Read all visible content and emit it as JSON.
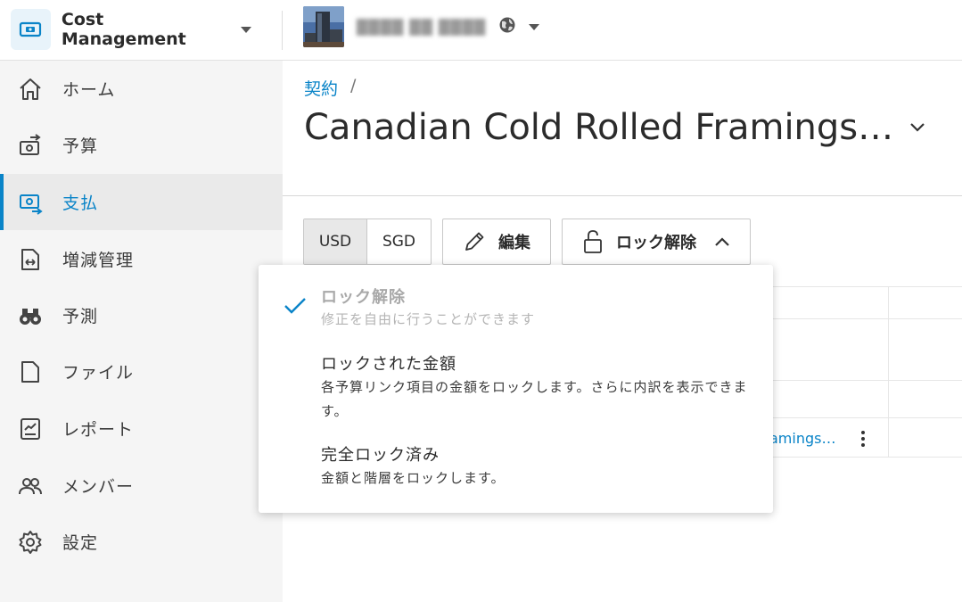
{
  "header": {
    "app_name": "Cost Management",
    "project_name": "████ ██ ████"
  },
  "sidebar": {
    "items": [
      {
        "label": "ホーム",
        "icon": "home-icon"
      },
      {
        "label": "予算",
        "icon": "budget-icon"
      },
      {
        "label": "支払",
        "icon": "payment-icon",
        "active": true
      },
      {
        "label": "増減管理",
        "icon": "change-order-icon"
      },
      {
        "label": "予測",
        "icon": "binoculars-icon"
      },
      {
        "label": "ファイル",
        "icon": "file-icon"
      },
      {
        "label": "レポート",
        "icon": "report-icon"
      },
      {
        "label": "メンバー",
        "icon": "members-icon"
      },
      {
        "label": "設定",
        "icon": "gear-icon"
      }
    ]
  },
  "main": {
    "breadcrumb": {
      "link": "契約",
      "separator": "/"
    },
    "title": "Canadian Cold Rolled Framings…",
    "toolbar": {
      "currencies": [
        "USD",
        "SGD"
      ],
      "selected_currency": "USD",
      "edit_label": "編集",
      "lock_label": "ロック解除"
    },
    "table": {
      "row_link": "amings…"
    }
  },
  "lock_menu": {
    "options": [
      {
        "title": "ロック解除",
        "desc": "修正を自由に行うことができます",
        "checked": true,
        "disabled": true
      },
      {
        "title": "ロックされた金額",
        "desc": "各予算リンク項目の金額をロックします。さらに内訳を表示できます。"
      },
      {
        "title": "完全ロック済み",
        "desc": "金額と階層をロックします。"
      }
    ]
  },
  "colors": {
    "accent": "#0a84c8",
    "sidebar_bg": "#f5f5f5",
    "active_bg": "#eaeaea"
  }
}
